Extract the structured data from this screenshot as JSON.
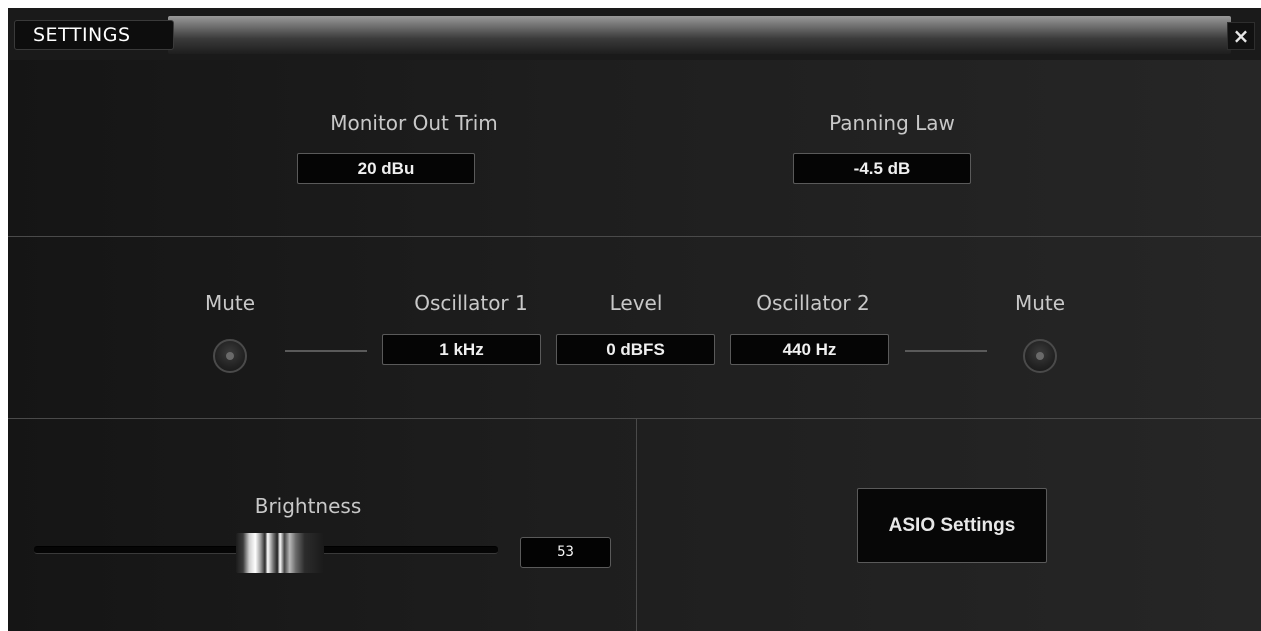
{
  "window": {
    "title": "SETTINGS",
    "close_label": "×"
  },
  "output": {
    "monitor_out_trim_label": "Monitor Out Trim",
    "monitor_out_trim_value": "20 dBu",
    "panning_law_label": "Panning Law",
    "panning_law_value": "-4.5 dB"
  },
  "oscillators": {
    "mute_left_label": "Mute",
    "osc1_label": "Oscillator 1",
    "osc1_value": "1 kHz",
    "level_label": "Level",
    "level_value": "0 dBFS",
    "osc2_label": "Oscillator 2",
    "osc2_value": "440 Hz",
    "mute_right_label": "Mute"
  },
  "display": {
    "brightness_label": "Brightness",
    "brightness_value": "53",
    "brightness_fraction": 0.53
  },
  "driver": {
    "asio_button_label": "ASIO Settings"
  }
}
